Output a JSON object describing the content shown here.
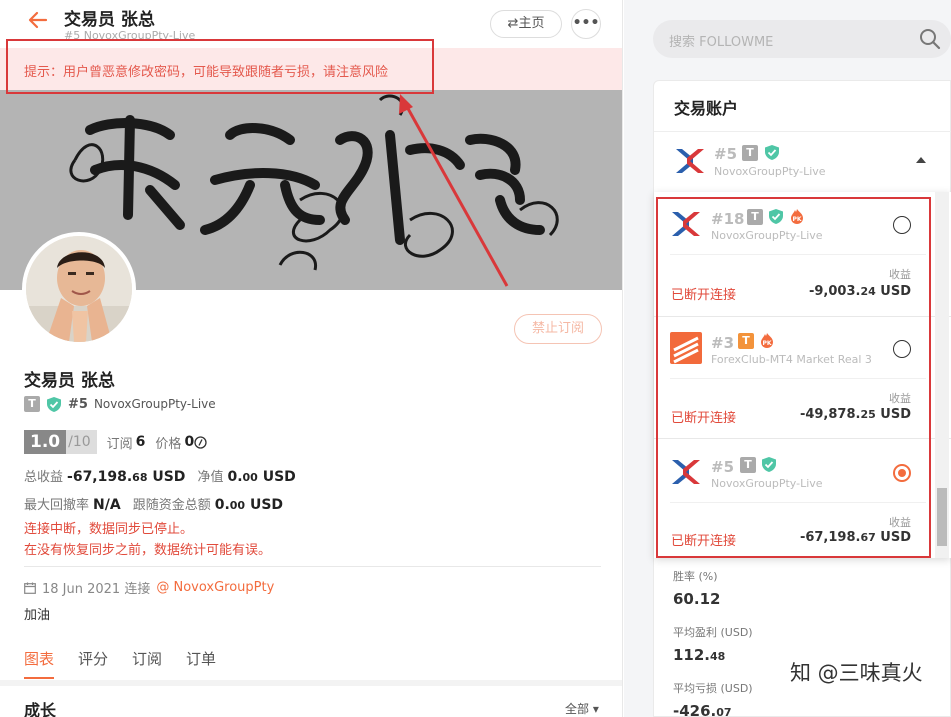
{
  "header": {
    "back_icon": "back-arrow-icon",
    "title": "交易员 张总",
    "subtitle": "#5  NovoxGroupPty-Live",
    "home_label": "⇄主页",
    "more_label": "•••"
  },
  "alert": {
    "text": "提示：用户曾恶意修改密码，可能导致跟随者亏损，请注意风险"
  },
  "banner": {
    "image": "calligraphy-banner"
  },
  "profile": {
    "stop_button": "禁止订阅",
    "name": "交易员 张总",
    "rank": "#5",
    "broker": "NovoxGroupPty-Live",
    "score": "1.0",
    "score_max": "/10",
    "subs_label": "订阅",
    "subs_value": "6",
    "price_label": "价格",
    "price_value": "0",
    "total_profit_label": "总收益",
    "total_profit_value": "-67,198.",
    "total_profit_dec": "68",
    "total_profit_unit": "USD",
    "equity_label": "净值",
    "equity_value": "0.",
    "equity_dec": "00",
    "equity_unit": "USD",
    "drawdown_label": "最大回撤率",
    "drawdown_value": "N/A",
    "follow_funds_label": "跟随资金总额",
    "follow_funds_value": "0.",
    "follow_funds_dec": "00",
    "follow_funds_unit": "USD",
    "warn1": "连接中断，数据同步已停止。",
    "warn2": "在没有恢复同步之前，数据统计可能有误。",
    "date": "18 Jun 2021 连接",
    "at_broker": "@ NovoxGroupPty",
    "note": "加油"
  },
  "tabs": [
    "图表",
    "评分",
    "订阅",
    "订单"
  ],
  "growth": {
    "title": "成长",
    "range": "全部 ▾"
  },
  "search": {
    "placeholder": "搜索 FOLLOWME"
  },
  "accounts": {
    "title": "交易账户",
    "current": {
      "num": "#5",
      "broker": "NovoxGroupPty-Live"
    },
    "items": [
      {
        "num": "#18",
        "broker": "NovoxGroupPty-Live",
        "profit_label": "收益",
        "status": "已断开连接",
        "profit": "-9,003.",
        "profit_dec": "24",
        "unit": "USD",
        "selected": false
      },
      {
        "num": "#3",
        "broker": "ForexClub-MT4 Market Real 3",
        "profit_label": "收益",
        "status": "已断开连接",
        "profit": "-49,878.",
        "profit_dec": "25",
        "unit": "USD",
        "selected": false
      },
      {
        "num": "#5",
        "broker": "NovoxGroupPty-Live",
        "profit_label": "收益",
        "status": "已断开连接",
        "profit": "-67,198.",
        "profit_dec": "67",
        "unit": "USD",
        "selected": true
      }
    ]
  },
  "right_stats": {
    "winrate_label": "胜率 (%)",
    "winrate_value": "60.12",
    "avg_profit_label": "平均盈利 (USD)",
    "avg_profit_value": "112.",
    "avg_profit_dec": "48",
    "avg_loss_label": "平均亏损 (USD)",
    "avg_loss_value": "-426.",
    "avg_loss_dec": "07"
  },
  "watermark": "知 @三味真火",
  "colors": {
    "accent": "#f36c3e",
    "alert_red": "#d9383a",
    "warn_text": "#e14a3b"
  }
}
